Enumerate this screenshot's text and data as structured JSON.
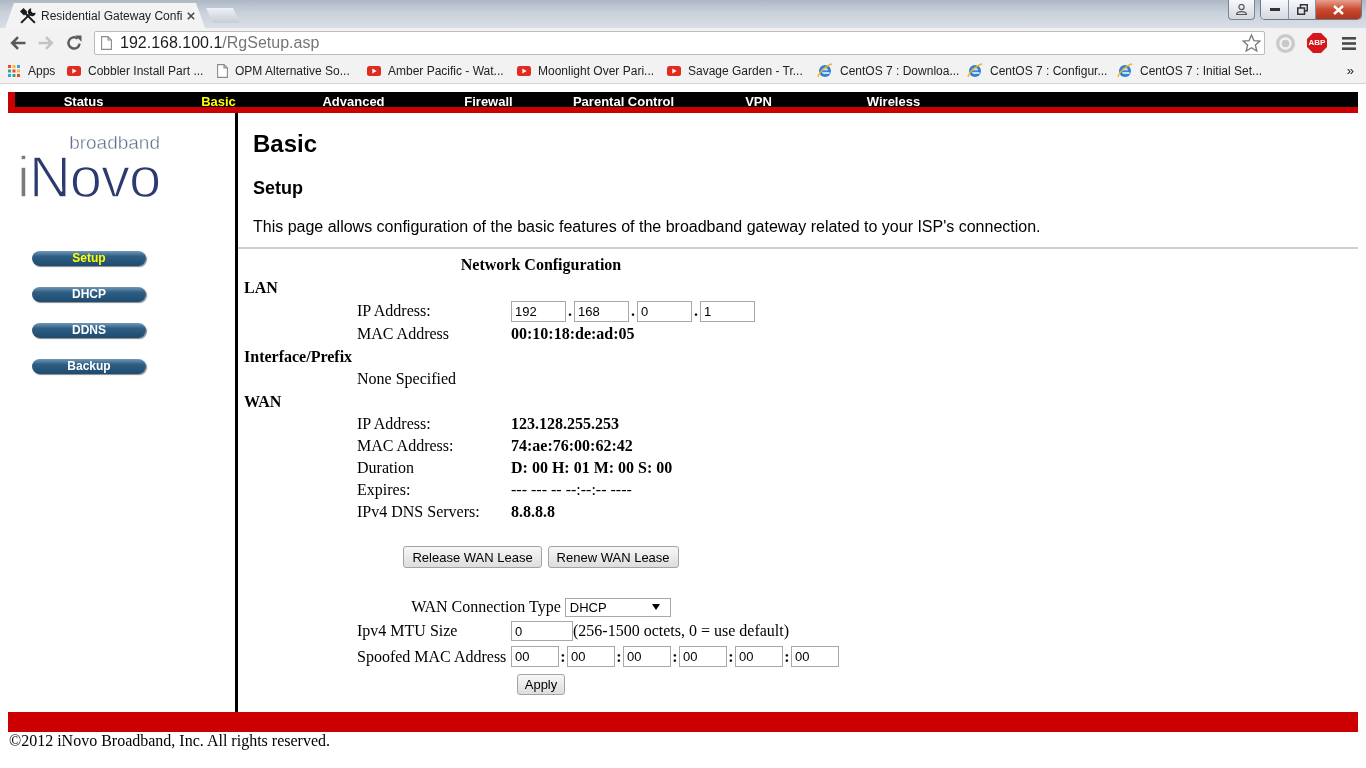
{
  "window": {
    "tabs": [
      {
        "title": "Residential Gateway Confi",
        "selected": true
      }
    ]
  },
  "toolbar": {
    "nav_buttons": [
      {
        "kind": "back",
        "disabled": false
      },
      {
        "kind": "forward",
        "disabled": true
      },
      {
        "kind": "reload",
        "disabled": false
      }
    ],
    "address": {
      "host": "192.168.100.1",
      "path": "/RgSetup.asp"
    },
    "extension_badge": "ABP"
  },
  "bookmarks": {
    "items": [
      {
        "kind": "apps",
        "label": "Apps"
      },
      {
        "kind": "video",
        "label": "Cobbler Install Part ..."
      },
      {
        "kind": "page",
        "label": "OPM Alternative So..."
      },
      {
        "kind": "video",
        "label": "Amber Pacific - Wat..."
      },
      {
        "kind": "video",
        "label": "Moonlight Over Pari..."
      },
      {
        "kind": "video",
        "label": "Savage Garden - Tr..."
      },
      {
        "kind": "e",
        "label": "CentOS 7 : Downloa..."
      },
      {
        "kind": "e",
        "label": "CentOS 7 : Configur..."
      },
      {
        "kind": "e",
        "label": "CentOS 7 : Initial Set..."
      }
    ],
    "overflow": "»"
  },
  "page": {
    "nav": [
      {
        "label": "Status",
        "selected": false
      },
      {
        "label": "Basic",
        "selected": true
      },
      {
        "label": "Advanced",
        "selected": false
      },
      {
        "label": "Firewall",
        "selected": false
      },
      {
        "label": "Parental Control",
        "selected": false
      },
      {
        "label": "VPN",
        "selected": false
      },
      {
        "label": "Wireless",
        "selected": false
      }
    ],
    "logo": {
      "name": "iNovo",
      "tagline": "broadband"
    },
    "sidebar": [
      {
        "label": "Setup",
        "selected": true
      },
      {
        "label": "DHCP",
        "selected": false
      },
      {
        "label": "DDNS",
        "selected": false
      },
      {
        "label": "Backup",
        "selected": false
      }
    ],
    "title": "Basic",
    "subtitle": "Setup",
    "description": "This page allows configuration of the basic features of the broadband gateway related to your ISP's connection.",
    "config": {
      "heading": "Network Configuration",
      "rows": [
        {
          "kind": "section",
          "label": "LAN"
        },
        {
          "kind": "ip_input",
          "label": "IP Address:",
          "separator": ".",
          "octets": [
            "192",
            "168",
            "0",
            "1"
          ]
        },
        {
          "kind": "value",
          "label": "MAC Address",
          "value": "00:10:18:de:ad:05",
          "bold": true
        },
        {
          "kind": "section",
          "label": "Interface/Prefix"
        },
        {
          "kind": "note",
          "label": "None Specified"
        },
        {
          "kind": "section",
          "label": "WAN"
        },
        {
          "kind": "value",
          "label": "IP Address:",
          "value": "123.128.255.253",
          "bold": true
        },
        {
          "kind": "value",
          "label": "MAC Address:",
          "value": "74:ae:76:00:62:42",
          "bold": true
        },
        {
          "kind": "value",
          "label": "Duration",
          "value": "D: 00 H: 01 M: 00 S: 00",
          "bold": true
        },
        {
          "kind": "value",
          "label": "Expires:",
          "value": "--- --- -- --:--:-- ----",
          "bold": false
        },
        {
          "kind": "value",
          "label": "IPv4 DNS Servers:",
          "value": "8.8.8.8",
          "bold": true
        }
      ],
      "lease_buttons": [
        "Release WAN Lease",
        "Renew WAN Lease"
      ],
      "connection_type": {
        "label": "WAN Connection Type",
        "value": "DHCP"
      },
      "mtu": {
        "label": "Ipv4 MTU Size",
        "value": "0",
        "hint": "(256-1500 octets, 0 = use default)"
      },
      "spoofed_mac": {
        "label": "Spoofed MAC Address",
        "separator": ":",
        "octets": [
          "00",
          "00",
          "00",
          "00",
          "00",
          "00"
        ]
      },
      "apply": "Apply"
    }
  },
  "footer": {
    "copyright": "©2012 iNovo Broadband, Inc. All rights reserved."
  }
}
